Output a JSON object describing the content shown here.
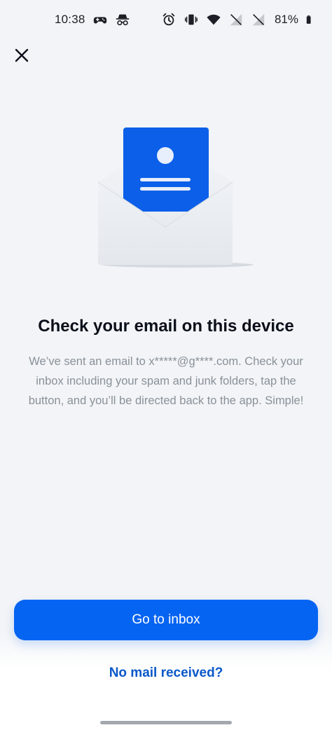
{
  "status_bar": {
    "time": "10:38",
    "battery": "81%",
    "icons": [
      "gamepad-icon",
      "incognito-icon",
      "alarm-icon",
      "vibrate-icon",
      "wifi-icon",
      "no-signal-icon",
      "no-signal-icon",
      "battery-icon"
    ]
  },
  "close": {
    "icon": "close-icon"
  },
  "main": {
    "title": "Check your email on this device",
    "body": "We’ve sent an email to x*****@g****.com. Check your inbox including your spam and junk folders, tap the button, and you’ll be directed back to the app. Simple!"
  },
  "actions": {
    "primary_label": "Go to inbox",
    "secondary_label": "No mail received?"
  },
  "colors": {
    "background": "#f2f4f7",
    "primary": "#0664f2",
    "link": "#0a58c8",
    "body_text": "#8a9199"
  }
}
